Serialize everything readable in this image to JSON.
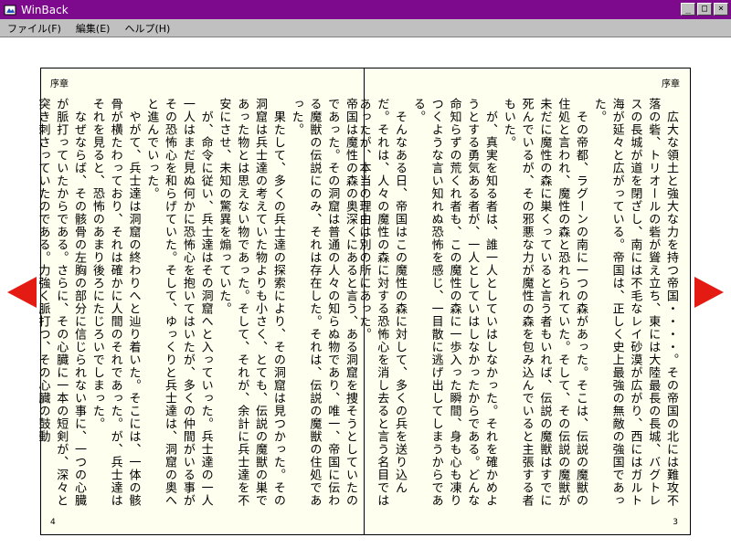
{
  "window": {
    "title": "WinBack",
    "minimize": "_",
    "maximize": "□",
    "close": "×"
  },
  "menu": [
    "ファイル(F)",
    "編集(E)",
    "ヘルプ(H)"
  ],
  "book": {
    "left": {
      "chapter": "序章",
      "page_number": "4",
      "text": "帝国は魔性の森の奥深くにあると言う、ある洞窟を捜そうとしていたのであった。その洞窟は普通の人々の知らぬ物であり、唯一、帝国に伝わる魔獣の伝説にのみ、それは存在した。それは、伝説の魔獣の住処であった。\n　果たして、多くの兵士達の探索により、その洞窟は見つかった。その洞窟は兵士達の考えていた物よりも小さく、とても、伝説の魔獣の巣であった物とは思えない物であった。そして、それが、余計に兵士達を不安にさせ、未知の驚異を煽っていた。\n　が、命令に従い、兵士達はその洞窟へと入っていった。兵士達の一人一人はまだ見ぬ何かに恐怖心を抱いてはいたが、多くの仲間がいる事がその恐怖心を和らげていた。そして、ゆっくりと兵士達は、洞窟の奥へと進んでいった。\n　やがて、兵士達は洞窟の終わりへと辿り着いた。そこには、一体の骸骨が横たわっており、それは確かに人間のそれであった。が、兵士達はそれを見ると、恐怖のあまり後ろにたじろいでしまった。\n　なぜならば、その骸骨の左胸の部分に信じられない事に、一つの心臓が脈打っていたからである。さらに、その心臓に一本の短剣が、深々と突き刺さっていたのである。力強く脈打つ、その心臓の鼓動"
    },
    "right": {
      "chapter": "序章",
      "page_number": "3",
      "text": "　広大な領土と強大な力を持つ帝国・・・・。その帝国の北には難攻不落の砦、トリオールの砦が聳え立ち、東には大陸最長の長城、バグトレスの長城が道を閉ざし、南には不毛なレイ砂漠が広がり、西にはガルト海が延々と広がっている。帝国は、正しく史上最強の無敵の強国であった。\n　その帝都、ラグーンの南に一つの森があった。そこは、伝説の魔獣の住処と言われ、魔性の森と恐れられていた。そして、その伝説の魔獣が未だに魔性の森に巣くっていると言う者もいれば、伝説の魔獣はすでに死んでいるが、その邪悪な力が魔性の森を包み込んでいると主張する者もいた。\n　が、真実を知る者は、誰一人としていはしなかった。それを確かめようとする勇気ある者が、一人としていはしなかったからである。どんな命知らずの荒くれ者も、この魔性の森に一歩入った瞬間、身も心も凍りつくような言い知れぬ恐怖を感じ、一目散に逃げ出してしまうからである。\n　そんなある日、帝国はこの魔性の森に対して、多くの兵を送り込んだ。それは、人々の魔性の森に対する恐怖心を消し去ると言う名目ではあったが、本当の理由は別の所にあった。"
    }
  },
  "navigation": {
    "prev_icon": "left-triangle",
    "next_icon": "right-triangle",
    "color": "#e31b12"
  }
}
